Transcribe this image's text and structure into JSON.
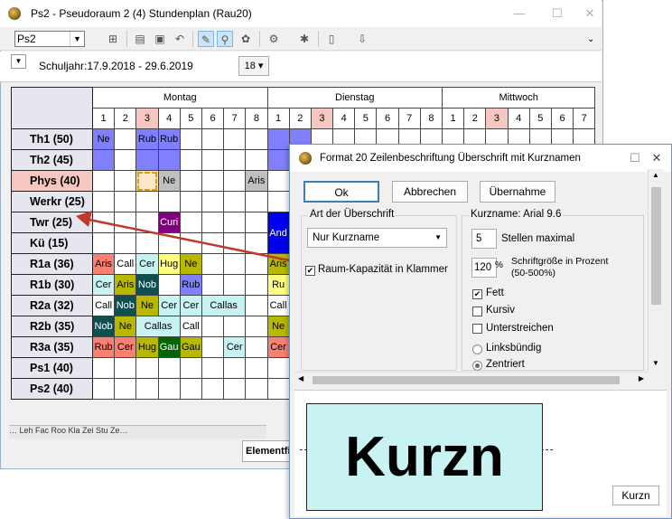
{
  "main_window": {
    "title": "Ps2 - Pseudoraum 2 (4)  Stundenplan  (Rau20)",
    "controls": {
      "min": "—",
      "max": "☐",
      "close": "✕"
    },
    "combo_value": "Ps2",
    "school_year": "Schuljahr:17.9.2018 - 29.6.2019",
    "cal_label": "18",
    "element_btn": "Elementfi",
    "tabs_text": "…  Leh  Fac  Roo  Kla  Zei  Stu  Ze…"
  },
  "timetable": {
    "days": [
      "Montag",
      "Dienstag",
      "Mittwoch"
    ],
    "periods_mon": [
      "1",
      "2",
      "3",
      "4",
      "5",
      "6",
      "7",
      "8"
    ],
    "periods_tue": [
      "1",
      "2",
      "3",
      "4",
      "5",
      "6",
      "7",
      "8"
    ],
    "periods_wed": [
      "1",
      "2",
      "3",
      "4",
      "5",
      "6",
      "7"
    ],
    "rows": [
      {
        "label": "Th1 (50)",
        "cells": [
          "",
          "Ne",
          "",
          "Rub",
          "Rub",
          "",
          "",
          "",
          ""
        ]
      },
      {
        "label": "Th2 (45)",
        "cells": []
      },
      {
        "label": "Phys (40)",
        "cells": [
          "",
          "",
          "",
          "",
          "Ne",
          "",
          "",
          "",
          "Aris"
        ]
      },
      {
        "label": "Werkr (25)",
        "cells": []
      },
      {
        "label": "Twr (25)",
        "cells": [
          "",
          "",
          "",
          "",
          "Curi",
          "",
          "",
          "",
          "",
          "And"
        ]
      },
      {
        "label": "Kü (15)",
        "cells": []
      },
      {
        "label": "R1a (36)",
        "cells": [
          "",
          "Aris",
          "Call",
          "Cer",
          "Hug",
          "Ne",
          "",
          "",
          "",
          "Aris"
        ]
      },
      {
        "label": "R1b (30)",
        "cells": [
          "",
          "Cer",
          "Aris",
          "Nob",
          "",
          "Rub",
          "",
          "",
          "",
          "Ru"
        ]
      },
      {
        "label": "R2a (32)",
        "cells": [
          "",
          "Call",
          "Nob",
          "Ne",
          "Cer",
          "Cer",
          "Callas",
          "",
          "",
          "Call"
        ]
      },
      {
        "label": "R2b (35)",
        "cells": [
          "",
          "Nob",
          "Ne",
          "Callas",
          "",
          "Call",
          "",
          "",
          "",
          "Ne"
        ]
      },
      {
        "label": "R3a (35)",
        "cells": [
          "",
          "Rub",
          "Cer",
          "Hug",
          "Gau",
          "Gau",
          "",
          "Cer",
          "",
          "Cer"
        ]
      },
      {
        "label": "Ps1 (40)",
        "cells": []
      },
      {
        "label": "Ps2 (40)",
        "cells": []
      }
    ]
  },
  "dialog": {
    "title": "Format 20  Zeilenbeschriftung  Überschrift mit Kurznamen",
    "ok": "Ok",
    "cancel": "Abbrechen",
    "apply": "Übernahme",
    "heading_type_label": "Art der Überschrift",
    "heading_type_value": "Nur Kurzname",
    "capacity_label": "Raum-Kapazität in Klammer",
    "capacity_checked": true,
    "kurzname_font": "Kurzname: Arial 9.6",
    "max_chars": "5",
    "max_chars_label": "Stellen maximal",
    "size_pct": "120",
    "pct_sign": "%",
    "size_label": "Schriftgröße in Prozent",
    "size_range": "(50-500%)",
    "bold_label": "Fett",
    "italic_label": "Kursiv",
    "underline_label": "Unterstreichen",
    "left_label": "Linksbündig",
    "center_label": "Zentriert",
    "preview_text": "Kurzn",
    "preview_btn": "Kurzn"
  },
  "colors": {
    "blue": "#8080ff",
    "gray": "#c0c0c0",
    "purple": "#800080",
    "salmon": "#fa8072",
    "olive": "#b8b800",
    "teal": "#0f4f4f",
    "lightcyan": "#c9f3f3",
    "green": "#006400",
    "yellow": "#ffff80",
    "arrow": "#c0392b",
    "preview_bg": "#c9f3f3"
  }
}
